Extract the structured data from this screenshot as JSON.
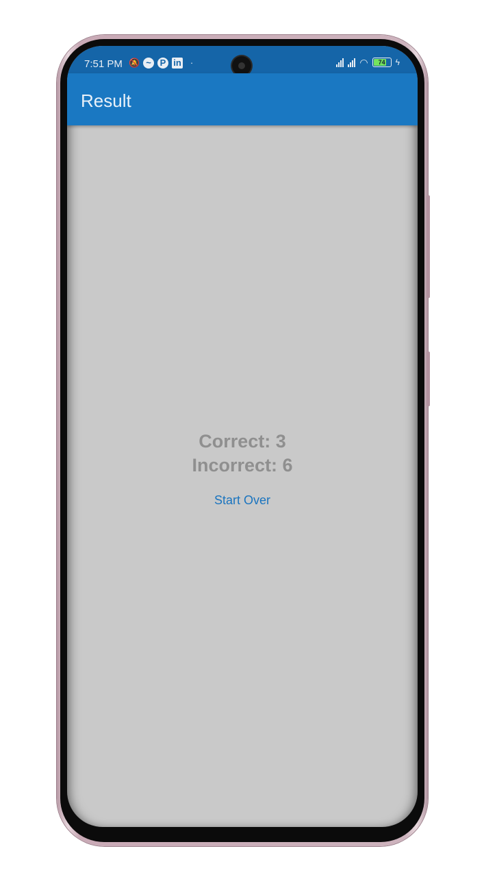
{
  "status_bar": {
    "time": "7:51 PM",
    "battery_level": "74",
    "icons": [
      "mute-icon",
      "messenger-icon",
      "app-icon",
      "linkedin-icon",
      "dot-icon",
      "signal-icon",
      "signal-icon",
      "wifi-icon",
      "battery-icon",
      "charging-icon"
    ]
  },
  "app_bar": {
    "title": "Result"
  },
  "result": {
    "correct_label": "Correct: 3",
    "incorrect_label": "Incorrect: 6",
    "start_over_label": "Start Over"
  },
  "colors": {
    "app_bar": "#1a78c2",
    "status_bar": "#1565a8",
    "background": "#c9c9c9",
    "result_text": "#8f8f8f",
    "button_text": "#1a74bf"
  }
}
